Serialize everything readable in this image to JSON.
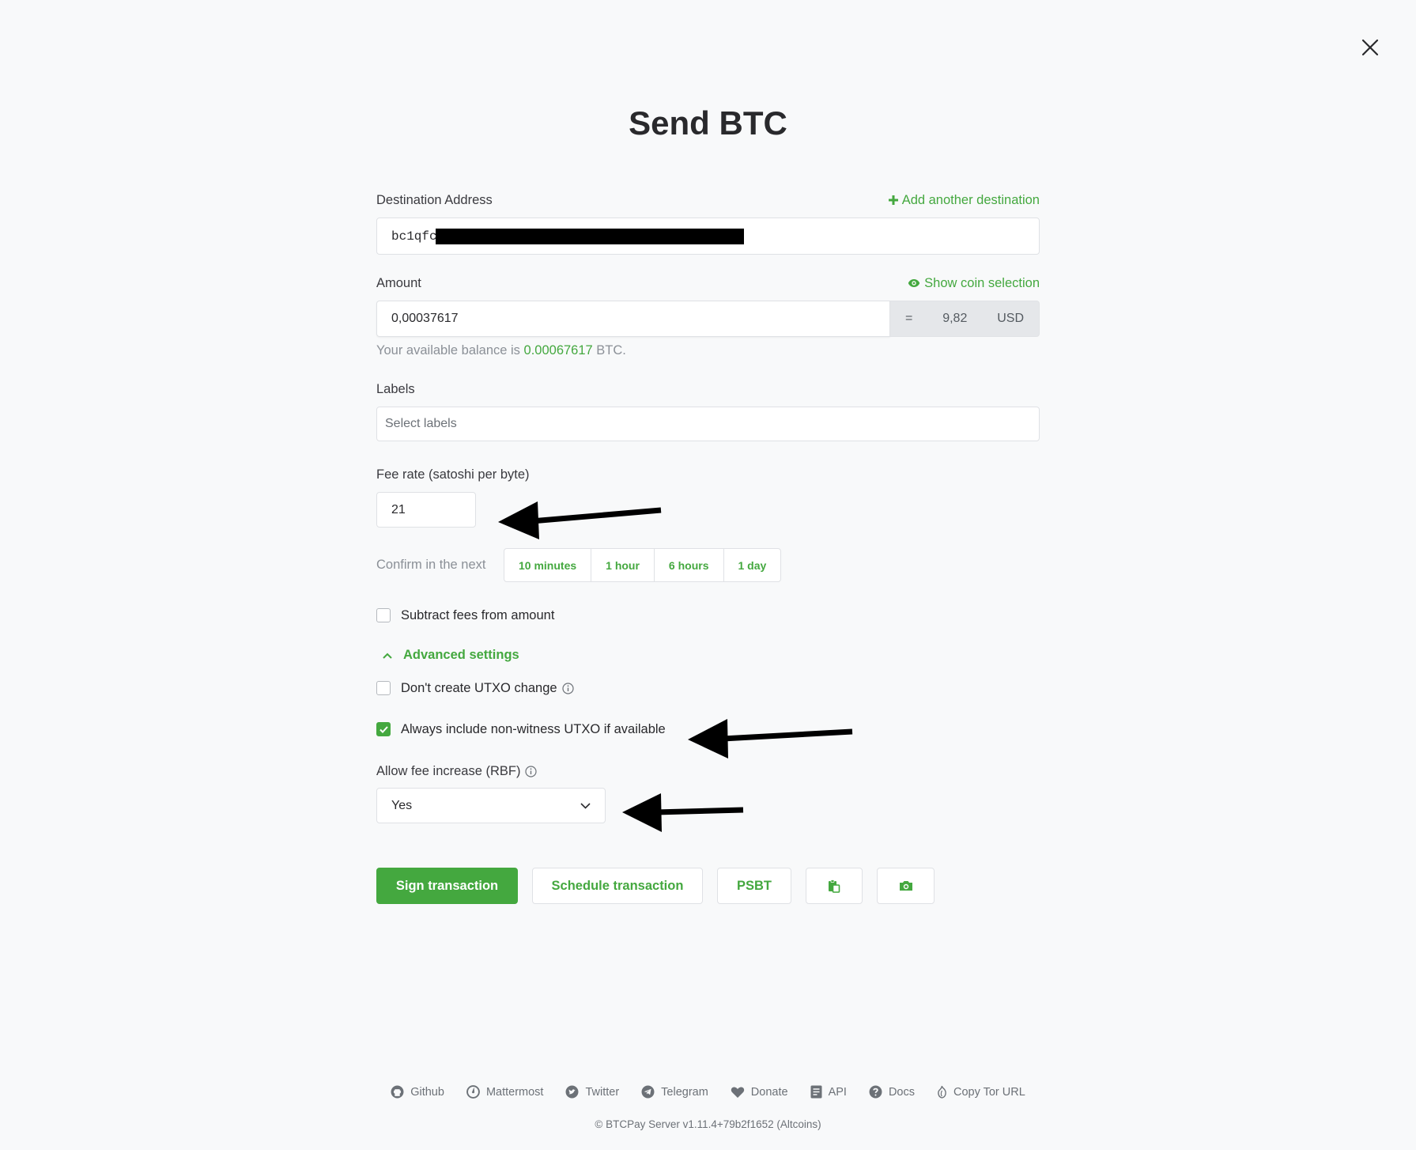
{
  "page": {
    "title": "Send BTC"
  },
  "destination": {
    "label": "Destination Address",
    "add_link": "Add another destination",
    "value_prefix": "bc1qfc"
  },
  "amount": {
    "label": "Amount",
    "coin_link": "Show coin selection",
    "value": "0,00037617",
    "equals": "=",
    "fiat_value": "9,82",
    "fiat_currency": "USD",
    "balance_prefix": "Your available balance is ",
    "balance_value": "0.00067617",
    "balance_suffix": " BTC."
  },
  "labels": {
    "label": "Labels",
    "placeholder": "Select labels"
  },
  "fee": {
    "label": "Fee rate (satoshi per byte)",
    "value": "21",
    "confirm_label": "Confirm in the next",
    "options": [
      "10 minutes",
      "1 hour",
      "6 hours",
      "1 day"
    ]
  },
  "subtract_fees": {
    "label": "Subtract fees from amount",
    "checked": false
  },
  "advanced": {
    "toggle_label": "Advanced settings",
    "no_change": {
      "label": "Don't create UTXO change",
      "checked": false
    },
    "non_witness": {
      "label": "Always include non-witness UTXO if available",
      "checked": true
    },
    "rbf_label": "Allow fee increase (RBF)",
    "rbf_value": "Yes"
  },
  "actions": {
    "sign": "Sign transaction",
    "schedule": "Schedule transaction",
    "psbt": "PSBT"
  },
  "footer": {
    "links": [
      "Github",
      "Mattermost",
      "Twitter",
      "Telegram",
      "Donate",
      "API",
      "Docs",
      "Copy Tor URL"
    ],
    "copyright": "© BTCPay Server v1.11.4+79b2f1652 (Altcoins)"
  },
  "colors": {
    "accent": "#44a83f",
    "background": "#f8f9fa",
    "addon": "#e5e7ea"
  }
}
